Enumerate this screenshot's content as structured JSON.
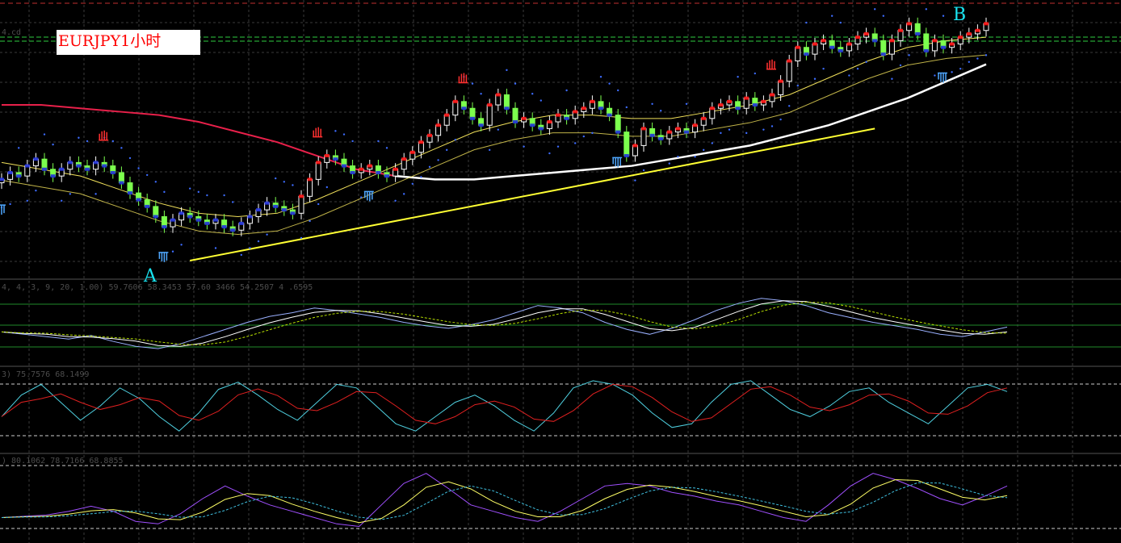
{
  "title": "EURJPY1小时",
  "point_labels": {
    "a": "A",
    "b": "B"
  },
  "indicator_texts": {
    "main_level": "4.cd",
    "osc1": "4, 4, 3, 9, 20, 1.00) 59.7606 58.3453 57.60  3466 54.2507 4 .6595",
    "osc2": "3) 75.7576 68.1499",
    "osc3": ") 80.1062 78.7166 68.8855"
  },
  "colors": {
    "background": "#000000",
    "bull_candle": "#ffffff",
    "bear_candle": "#7cff4e",
    "ma_slow_early": "#e8204a",
    "ma_slow_late": "#ffffff",
    "ma_mid": "#f0e05a",
    "parabolic_sar": "#3d6cff",
    "trendline": "#ffff33",
    "up_fractal": "#ff3030",
    "down_fractal": "#4fa8ff",
    "level_line": "#2ecc40"
  },
  "chart_data": [
    {
      "type": "candlestick",
      "title": "EURJPY1小时",
      "x": "bar index (hourly)",
      "close": [
        146.9,
        147.1,
        147.0,
        147.3,
        147.5,
        147.2,
        147.0,
        147.2,
        147.4,
        147.3,
        147.2,
        147.4,
        147.3,
        147.1,
        146.8,
        146.5,
        146.3,
        146.1,
        145.8,
        145.5,
        145.7,
        145.9,
        145.8,
        145.7,
        145.6,
        145.7,
        145.5,
        145.4,
        145.6,
        145.8,
        146.0,
        146.2,
        146.1,
        146.0,
        145.9,
        146.4,
        146.9,
        147.4,
        147.6,
        147.5,
        147.3,
        147.1,
        147.2,
        147.3,
        147.1,
        147.0,
        147.2,
        147.5,
        147.7,
        148.0,
        148.2,
        148.5,
        148.8,
        149.2,
        149.0,
        148.7,
        148.5,
        149.1,
        149.4,
        149.0,
        148.6,
        148.7,
        148.5,
        148.4,
        148.6,
        148.8,
        148.7,
        148.9,
        149.0,
        149.2,
        149.0,
        148.8,
        148.3,
        147.6,
        147.9,
        148.4,
        148.2,
        148.1,
        148.3,
        148.4,
        148.3,
        148.5,
        148.7,
        149.0,
        149.1,
        149.2,
        149.0,
        149.3,
        149.1,
        149.2,
        149.4,
        149.8,
        150.4,
        150.8,
        150.6,
        150.9,
        151.0,
        150.8,
        150.7,
        150.9,
        151.1,
        151.2,
        151.0,
        150.6,
        151.0,
        151.3,
        151.5,
        151.2,
        150.7,
        151.0,
        150.8,
        150.9,
        151.1,
        151.2,
        151.3,
        151.5
      ],
      "ma_slow": [
        149.1,
        149.1,
        149.0,
        148.9,
        148.8,
        148.6,
        148.3,
        148.0,
        147.6,
        147.2,
        147.0,
        146.9,
        146.9,
        147.0,
        147.1,
        147.2,
        147.3,
        147.5,
        147.7,
        147.9,
        148.2,
        148.5,
        148.9,
        149.3,
        149.8,
        150.3
      ],
      "ma_mid": [
        147.4,
        147.2,
        147.0,
        146.6,
        146.2,
        145.9,
        145.8,
        145.9,
        146.3,
        146.8,
        147.3,
        147.8,
        148.3,
        148.6,
        148.8,
        148.8,
        148.7,
        148.7,
        148.9,
        149.1,
        149.4,
        149.9,
        150.4,
        150.8,
        151.0,
        151.1
      ],
      "trendline": {
        "from": [
          22,
          144.5
        ],
        "to": [
          102,
          148.4
        ]
      },
      "points": [
        {
          "label": "A",
          "bar": 18,
          "price": 144.6
        },
        {
          "label": "B",
          "bar": 103,
          "price": 151.8
        }
      ]
    },
    {
      "type": "line",
      "series": [
        {
          "values": [
            42,
            40,
            38,
            36,
            39,
            34,
            30,
            28,
            32,
            38,
            44,
            50,
            55,
            58,
            62,
            60,
            57,
            54,
            50,
            47,
            45,
            48,
            52,
            58,
            64,
            62,
            58,
            50,
            44,
            40,
            45,
            52,
            60,
            66,
            70,
            68,
            64,
            58,
            54,
            50,
            47,
            44,
            40,
            38,
            42,
            46
          ]
        }
      ]
    },
    {
      "type": "line",
      "ylim": [
        0,
        100
      ],
      "series": [
        {
          "values": [
            40,
            70,
            85,
            60,
            35,
            55,
            80,
            65,
            40,
            20,
            45,
            78,
            88,
            70,
            50,
            35,
            60,
            85,
            80,
            55,
            30,
            20,
            40,
            60,
            70,
            55,
            35,
            20,
            45,
            80,
            90,
            85,
            70,
            45,
            25,
            30,
            60,
            85,
            90,
            70,
            50,
            40,
            55,
            75,
            80,
            60,
            45,
            30,
            55,
            80,
            85,
            75
          ]
        }
      ]
    },
    {
      "type": "line",
      "series": [
        {
          "values": [
            45,
            46,
            47,
            50,
            54,
            50,
            42,
            40,
            48,
            60,
            70,
            62,
            55,
            50,
            45,
            40,
            38,
            55,
            72,
            80,
            68,
            55,
            50,
            45,
            42,
            50,
            60,
            70,
            72,
            70,
            65,
            62,
            58,
            55,
            50,
            45,
            42,
            55,
            70,
            80,
            75,
            68,
            60,
            55,
            62,
            70
          ]
        }
      ]
    }
  ]
}
